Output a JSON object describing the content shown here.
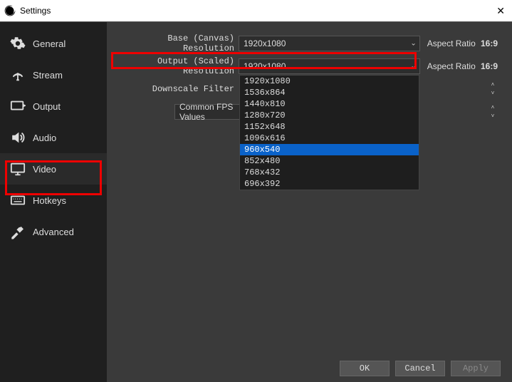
{
  "window": {
    "title": "Settings"
  },
  "sidebar": {
    "items": [
      {
        "label": "General"
      },
      {
        "label": "Stream"
      },
      {
        "label": "Output"
      },
      {
        "label": "Audio"
      },
      {
        "label": "Video"
      },
      {
        "label": "Hotkeys"
      },
      {
        "label": "Advanced"
      }
    ]
  },
  "video": {
    "base": {
      "label": "Base (Canvas) Resolution",
      "value": "1920x1080",
      "aspect_label": "Aspect Ratio",
      "aspect_value": "16:9"
    },
    "output": {
      "label": "Output (Scaled) Resolution",
      "value": "1920x1080",
      "aspect_label": "Aspect Ratio",
      "aspect_value": "16:9",
      "options": [
        "1920x1080",
        "1536x864",
        "1440x810",
        "1280x720",
        "1152x648",
        "1096x616",
        "960x540",
        "852x480",
        "768x432",
        "696x392"
      ],
      "selected_index": 6
    },
    "downscale": {
      "label": "Downscale Filter"
    },
    "fps": {
      "label": "Common FPS Values"
    }
  },
  "footer": {
    "ok": "OK",
    "cancel": "Cancel",
    "apply": "Apply"
  }
}
